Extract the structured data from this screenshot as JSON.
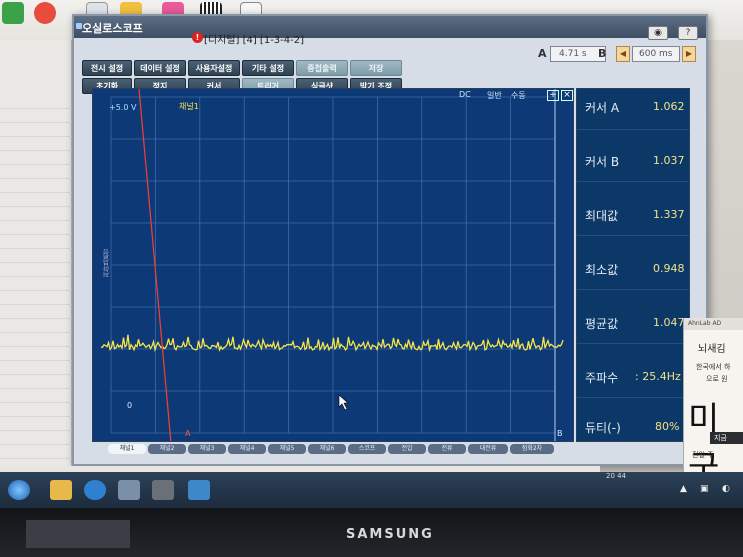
{
  "window": {
    "title": "오실로스코프",
    "document_title": "[디지털] [4] [1-3-4-2]"
  },
  "menu_row1": [
    "전시 설정",
    "데이터 설정",
    "사용자설정",
    "기타 설정",
    "중첩출력",
    "저장"
  ],
  "menu_row2": [
    "초기화",
    "정지",
    "커서",
    "트리거",
    "싱글샷",
    "밝기 조정"
  ],
  "cursor_controls": {
    "a_label": "A",
    "a_value": "4.71 s",
    "b_label": "B",
    "b_value": "600 ms"
  },
  "screen": {
    "coupling": "DC",
    "mode_normal": "일반",
    "mode_manual": "수동",
    "volt_scale": "+5.0 V",
    "channel_label": "채널1",
    "zero_marker": "0",
    "cursor_a": "A",
    "cursor_b": "B",
    "side_label": "전압설정"
  },
  "measurements": [
    {
      "label": "커서 A",
      "value": "1.062"
    },
    {
      "label": "커서 B",
      "value": "1.037"
    },
    {
      "label": "최대값",
      "value": "1.337"
    },
    {
      "label": "최소값",
      "value": "0.948"
    },
    {
      "label": "평균값",
      "value": "1.047"
    },
    {
      "label": "주파수",
      "value": ": 25.4Hz"
    },
    {
      "label": "듀티(-)",
      "value": "80%"
    }
  ],
  "tabs": [
    "채널1",
    "채널2",
    "채널3",
    "채널4",
    "채널5",
    "채널6",
    "스코프",
    "전압",
    "전류",
    "대전류",
    "점화2차"
  ],
  "ad": {
    "header": "AhnLab AD",
    "title": "뇌새김",
    "line1": "한국에서 하",
    "line2": "으로 원",
    "big": "미국",
    "button": "지금",
    "footer": "전일 주"
  },
  "taskbar": {
    "clock": "20 44"
  },
  "monitor": {
    "brand": "SAMSUNG"
  },
  "colors": {
    "screen_bg": "#0d3a76",
    "grid": "#3d6aa8",
    "trace": "#f5e54a",
    "cursor_a": "#ff3b30"
  }
}
